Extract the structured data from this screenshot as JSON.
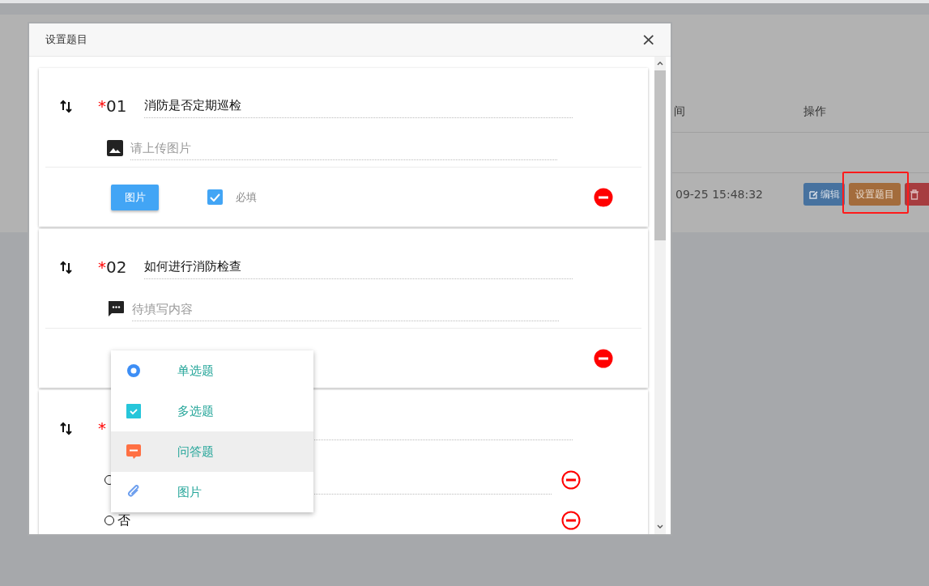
{
  "background_table": {
    "columns": [
      "间",
      "操作"
    ],
    "rows": [
      {
        "time": "09-25 15:48:32",
        "actions": [
          {
            "kind": "edit",
            "label": "编辑"
          },
          {
            "kind": "setup",
            "label": "设置题目",
            "highlighted": true
          },
          {
            "kind": "delete"
          }
        ]
      }
    ]
  },
  "dialog": {
    "title": "设置题目",
    "close": "×",
    "questions": [
      {
        "kind": "upload",
        "required_mark": "*",
        "number": "01",
        "text": "消防是否定期巡检",
        "placeholder": "请上传图片",
        "type_button": "图片",
        "required_checkbox": {
          "label": "必填",
          "checked": true
        }
      },
      {
        "kind": "text",
        "required_mark": "*",
        "number": "02",
        "text": "如何进行消防检查",
        "placeholder": "待填写内容"
      },
      {
        "kind": "choice",
        "required_mark": "*",
        "options": [
          {
            "checked": false
          },
          {
            "checked": false,
            "label": "否"
          }
        ]
      }
    ],
    "type_menu": [
      {
        "kind": "single",
        "label": "单选题",
        "selected": false
      },
      {
        "kind": "multi",
        "label": "多选题",
        "selected": false
      },
      {
        "kind": "qa",
        "label": "问答题",
        "selected": true
      },
      {
        "kind": "image",
        "label": "图片",
        "selected": false
      }
    ]
  }
}
